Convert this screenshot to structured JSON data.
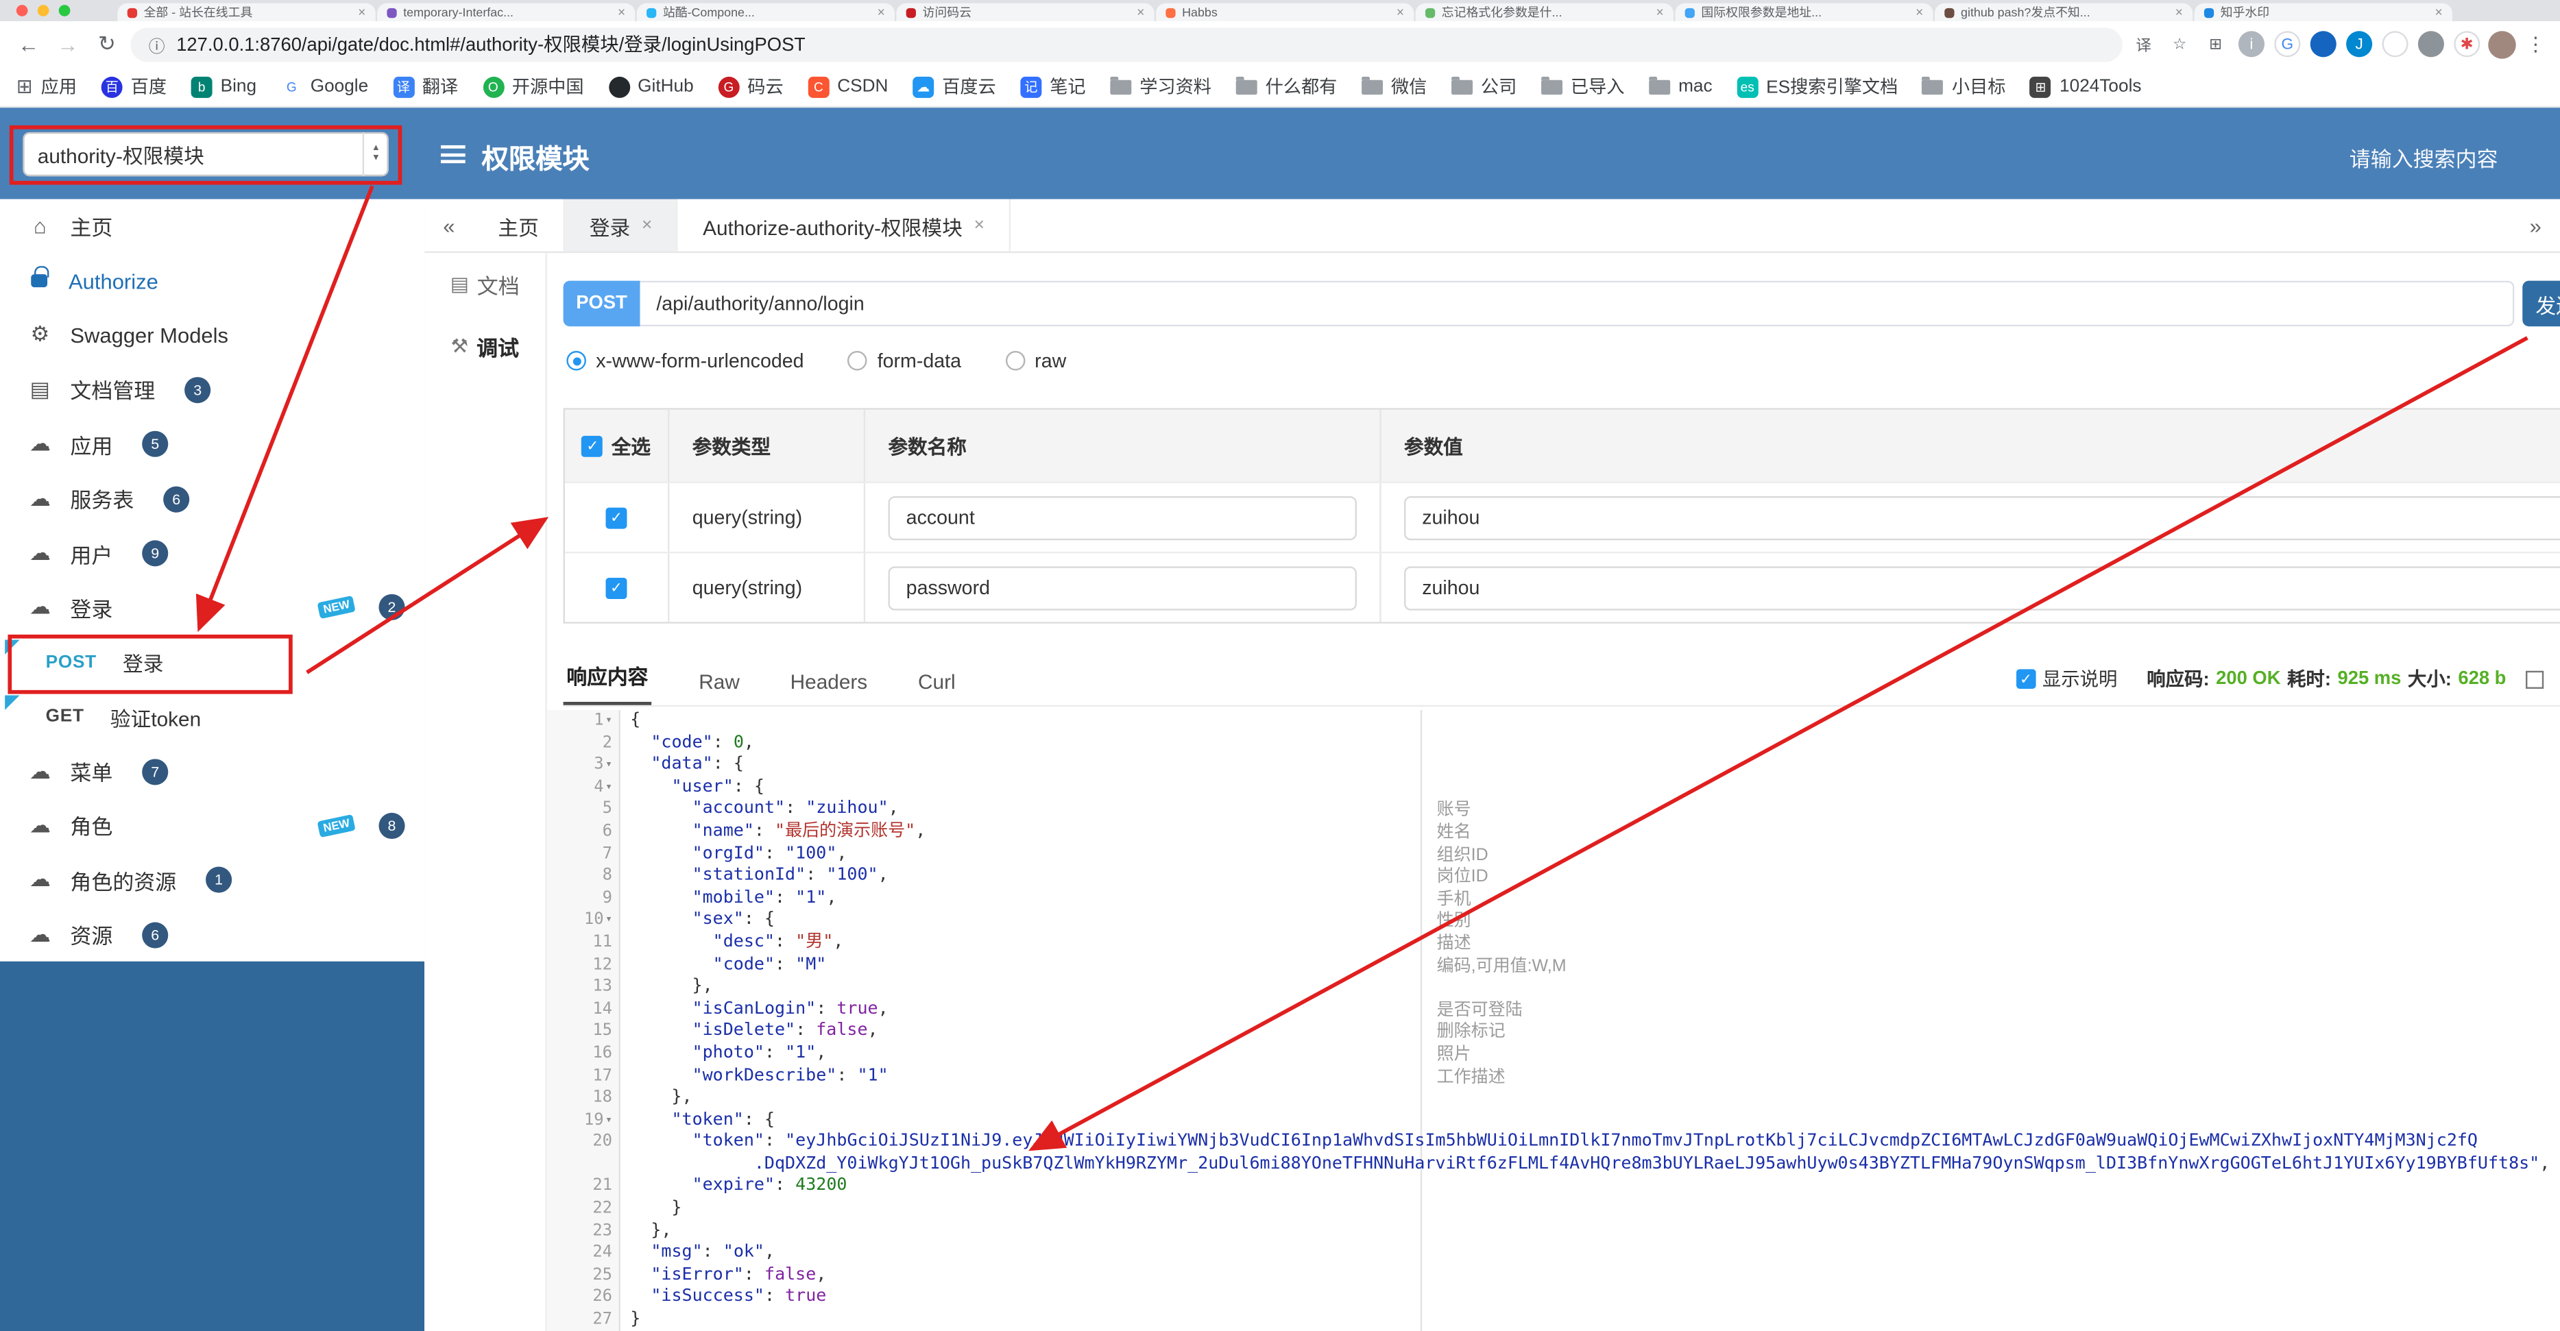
{
  "browser": {
    "traffic_lights": [
      "#ff5f57",
      "#febc2e",
      "#28c840"
    ],
    "tabs": [
      {
        "title": "全部 - 站长在线工具",
        "color": "#e53935"
      },
      {
        "title": "temporary-Interfac...",
        "color": "#7e57c2"
      },
      {
        "title": "站酷-Compone...",
        "color": "#29b6f6"
      },
      {
        "title": "访问码云",
        "color": "#c71d23"
      },
      {
        "title": "Habbs",
        "color": "#ff7043"
      },
      {
        "title": "忘记格式化参数是什...",
        "color": "#66bb6a"
      },
      {
        "title": "国际权限参数是地址...",
        "color": "#42a5f5"
      },
      {
        "title": "github pash?发点不知...",
        "color": "#6d4c41"
      },
      {
        "title": "知乎水印",
        "color": "#1e88e5"
      }
    ],
    "address_url": "127.0.0.1:8760/api/gate/doc.html#/authority-权限模块/登录/loginUsingPOST",
    "toolbar_icons": [
      {
        "name": "translate-icon",
        "glyph": "译",
        "fg": "#5f6368"
      },
      {
        "name": "bookmark-star-icon",
        "glyph": "☆",
        "fg": "#5f6368"
      },
      {
        "name": "extensions-grid-icon",
        "glyph": "⊞",
        "fg": "#5f6368"
      },
      {
        "name": "extension-info-icon",
        "glyph": "i",
        "bg": "#b0b6bd",
        "fg": "#ffffff"
      },
      {
        "name": "extension-google-icon",
        "glyph": "G",
        "bg": "#ffffff",
        "fg": "#4285f4",
        "border": "#dadce0"
      },
      {
        "name": "extension-icon",
        "glyph": "",
        "bg": "#1565c0"
      },
      {
        "name": "extension-jsp-icon",
        "glyph": "J",
        "bg": "#0288d1",
        "fg": "#ffffff"
      },
      {
        "name": "extension-icon",
        "glyph": "",
        "bg": "#ffffff",
        "border": "#dadce0"
      },
      {
        "name": "extension-shield-icon",
        "glyph": "",
        "bg": "#8d9499"
      },
      {
        "name": "extension-pin-icon",
        "glyph": "✱",
        "bg": "#ffffff",
        "fg": "#e04646",
        "border": "#dadce0"
      }
    ],
    "bookmarks": [
      {
        "label": "应用",
        "fav": "apps"
      },
      {
        "label": "百度",
        "fav": "dot",
        "color": "#2932e1",
        "letter": "百"
      },
      {
        "label": "Bing",
        "fav": "square",
        "color": "#008373",
        "letter": "b"
      },
      {
        "label": "Google",
        "fav": "square",
        "color": "#ffffff",
        "fg": "#4285f4",
        "letter": "G"
      },
      {
        "label": "翻译",
        "fav": "square",
        "color": "#3b82f6",
        "letter": "译"
      },
      {
        "label": "开源中国",
        "fav": "dot",
        "color": "#21b351",
        "letter": "O"
      },
      {
        "label": "GitHub",
        "fav": "dot",
        "color": "#24292e",
        "letter": ""
      },
      {
        "label": "码云",
        "fav": "dot",
        "color": "#c71d23",
        "letter": "G"
      },
      {
        "label": "CSDN",
        "fav": "square",
        "color": "#fc5531",
        "letter": "C"
      },
      {
        "label": "百度云",
        "fav": "square",
        "color": "#2196f3",
        "letter": "☁"
      },
      {
        "label": "笔记",
        "fav": "square",
        "color": "#3370ff",
        "letter": "记"
      },
      {
        "label": "学习资料",
        "fav": "folder"
      },
      {
        "label": "什么都有",
        "fav": "folder"
      },
      {
        "label": "微信",
        "fav": "folder"
      },
      {
        "label": "公司",
        "fav": "folder"
      },
      {
        "label": "已导入",
        "fav": "folder"
      },
      {
        "label": "mac",
        "fav": "folder"
      },
      {
        "label": "ES搜索引擎文档",
        "fav": "square",
        "color": "#00bfb3",
        "letter": "es"
      },
      {
        "label": "小目标",
        "fav": "folder"
      },
      {
        "label": "1024Tools",
        "fav": "square",
        "color": "#444444",
        "letter": "⊞"
      }
    ]
  },
  "header": {
    "group_select": "authority-权限模块",
    "title": "权限模块",
    "search_placeholder": "请输入搜索内容"
  },
  "sidebar": {
    "items": [
      {
        "icon": "home",
        "label": "主页"
      },
      {
        "icon": "lock",
        "label": "Authorize",
        "accent": true
      },
      {
        "icon": "models",
        "label": "Swagger Models"
      },
      {
        "icon": "docs",
        "label": "文档管理",
        "badge": "3"
      },
      {
        "icon": "cloud",
        "label": "应用",
        "badge": "5"
      },
      {
        "icon": "cloud",
        "label": "服务表",
        "badge": "6"
      },
      {
        "icon": "cloud",
        "label": "用户",
        "badge": "9"
      },
      {
        "icon": "cloud",
        "label": "登录",
        "badge": "2",
        "isNew": true
      },
      {
        "method": "POST",
        "label": "登录",
        "highlighted": true
      },
      {
        "method": "GET",
        "label": "验证token"
      },
      {
        "icon": "cloud",
        "label": "菜单",
        "badge": "7"
      },
      {
        "icon": "cloud",
        "label": "角色",
        "badge": "8",
        "isNew": true
      },
      {
        "icon": "cloud",
        "label": "角色的资源",
        "badge": "1"
      },
      {
        "icon": "cloud",
        "label": "资源",
        "badge": "6"
      }
    ]
  },
  "view_tabs": {
    "prev": "«",
    "next": "»",
    "tabs": [
      {
        "label": "主页"
      },
      {
        "label": "登录",
        "closable": true,
        "active": true
      },
      {
        "label": "Authorize-authority-权限模块",
        "closable": true
      }
    ]
  },
  "doc_tabs": [
    {
      "label": "文档",
      "icon": "▤"
    },
    {
      "label": "调试",
      "icon": "⚒",
      "active": true
    }
  ],
  "debug": {
    "method": "POST",
    "path": "/api/authority/anno/login",
    "send_label": "发送",
    "content_types": [
      {
        "label": "x-www-form-urlencoded",
        "selected": true
      },
      {
        "label": "form-data"
      },
      {
        "label": "raw"
      }
    ],
    "params_table": {
      "select_all_label": "全选",
      "headers": [
        "参数类型",
        "参数名称",
        "参数值"
      ],
      "rows": [
        {
          "checked": true,
          "type": "query(string)",
          "name": "account",
          "value": "zuihou"
        },
        {
          "checked": true,
          "type": "query(string)",
          "name": "password",
          "value": "zuihou"
        }
      ]
    }
  },
  "response": {
    "tabs": [
      {
        "label": "响应内容",
        "active": true
      },
      {
        "label": "Raw"
      },
      {
        "label": "Headers"
      },
      {
        "label": "Curl"
      }
    ],
    "show_desc_label": "显示说明",
    "status_label": "响应码:",
    "status_value": "200 OK",
    "time_label": "耗时:",
    "time_value": "925 ms",
    "size_label": "大小:",
    "size_value": "628 b"
  },
  "code": {
    "lines": [
      {
        "no": 1,
        "fold": true,
        "text": "{"
      },
      {
        "no": 2,
        "text": "  \"code\": 0,"
      },
      {
        "no": 3,
        "fold": true,
        "text": "  \"data\": {"
      },
      {
        "no": 4,
        "fold": true,
        "text": "    \"user\": {"
      },
      {
        "no": 5,
        "text": "      \"account\": \"zuihou\",",
        "note": "账号"
      },
      {
        "no": 6,
        "text": "      \"name\": \"最后的演示账号\",",
        "note": "姓名"
      },
      {
        "no": 7,
        "text": "      \"orgId\": \"100\",",
        "note": "组织ID"
      },
      {
        "no": 8,
        "text": "      \"stationId\": \"100\",",
        "note": "岗位ID"
      },
      {
        "no": 9,
        "text": "      \"mobile\": \"1\",",
        "note": "手机"
      },
      {
        "no": 10,
        "fold": true,
        "text": "      \"sex\": {",
        "note": "性别"
      },
      {
        "no": 11,
        "text": "        \"desc\": \"男\",",
        "note": "描述"
      },
      {
        "no": 12,
        "text": "        \"code\": \"M\"",
        "note": "编码,可用值:W,M"
      },
      {
        "no": 13,
        "text": "      },"
      },
      {
        "no": 14,
        "text": "      \"isCanLogin\": true,",
        "note": "是否可登陆"
      },
      {
        "no": 15,
        "text": "      \"isDelete\": false,",
        "note": "删除标记"
      },
      {
        "no": 16,
        "text": "      \"photo\": \"1\",",
        "note": "照片"
      },
      {
        "no": 17,
        "text": "      \"workDescribe\": \"1\"",
        "note": "工作描述"
      },
      {
        "no": 18,
        "text": "    },"
      },
      {
        "no": 19,
        "fold": true,
        "text": "    \"token\": {"
      },
      {
        "no": 20,
        "text": "      \"token\": \"eyJhbGciOiJSUzI1NiJ9.eyJzdWIiOiIyIiwiYWNjb3VudCI6Inp1aWhvdSIsIm5hbWUiOiLmnIDlkI7nmoTmvJTnpLrotKblj7ciLCJvcmdpZCI6MTAwLCJzdGF0aW9uaWQiOjEwMCwiZXhwIjoxNTY4MjM3Njc2fQ\n            .DqDXZd_Y0iWkgYJt1OGh_puSkB7QZlWmYkH9RZYMr_2uDul6mi88YOneTFHNNuHarviRtf6zFLMLf4AvHQre8m3bUYLRaeLJ95awhUyw0s43BYZTLFMHa79OynSWqpsm_lDI3BfnYnwXrgGOGTeL6htJ1YUIx6Yy19BYBfUft8s\","
      },
      {
        "no": 21,
        "text": "      \"expire\": 43200"
      },
      {
        "no": 22,
        "text": "    }"
      },
      {
        "no": 23,
        "text": "  },"
      },
      {
        "no": 24,
        "text": "  \"msg\": \"ok\","
      },
      {
        "no": 25,
        "text": "  \"isError\": false,"
      },
      {
        "no": 26,
        "text": "  \"isSuccess\": true"
      },
      {
        "no": 27,
        "text": "}"
      }
    ]
  },
  "colors": {
    "header_blue": "#4a80b8",
    "sidebar_fill_blue": "#2f6899",
    "annotation_red": "#e01f1f",
    "success_green": "#55b025",
    "method_post_teal": "#2aa0c8",
    "primary_button_blue": "#2f6da4"
  }
}
